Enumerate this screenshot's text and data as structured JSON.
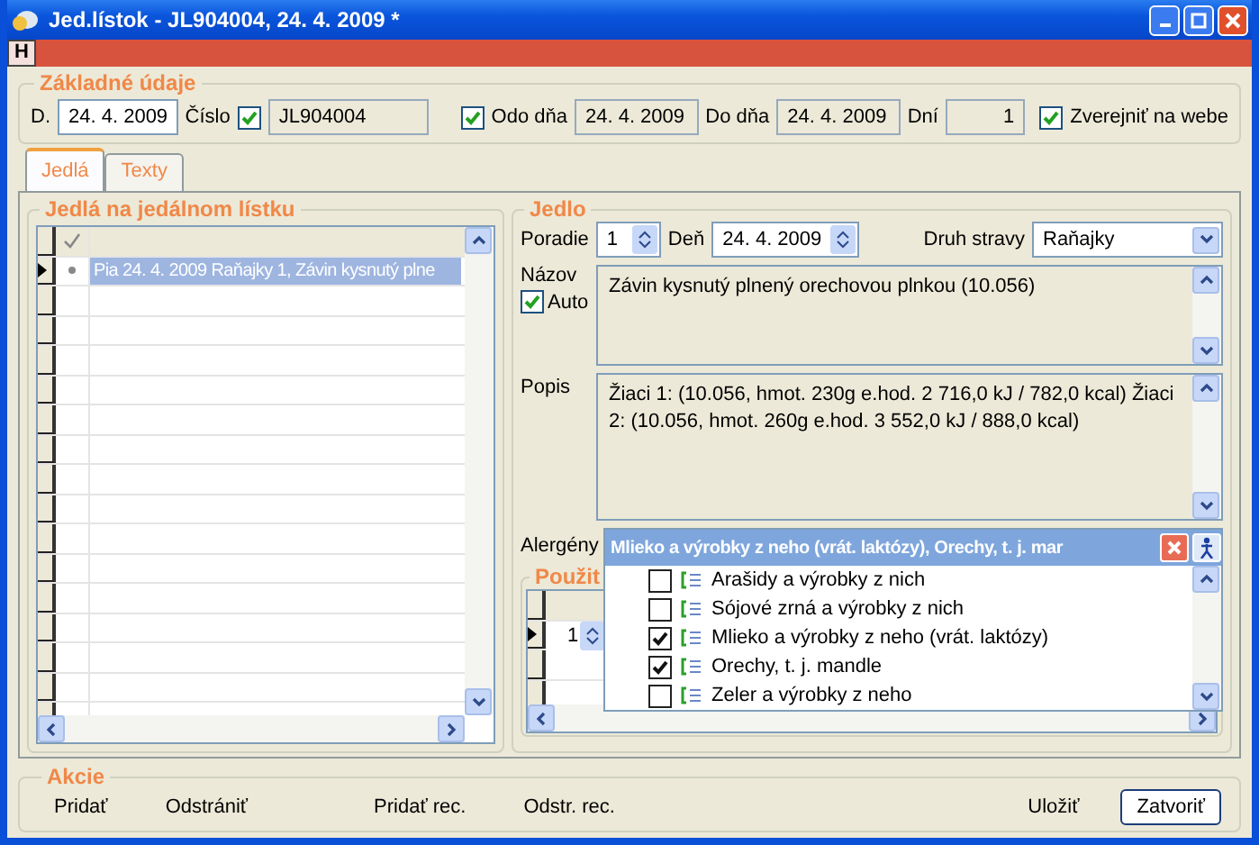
{
  "window": {
    "title": "Jed.lístok - JL904004, 24. 4. 2009 *"
  },
  "toolbar": {
    "button": "H"
  },
  "basic": {
    "title": "Základné údaje",
    "date_label": "D.",
    "date": "24. 4. 2009",
    "number_label": "Číslo",
    "number_checked": true,
    "number": "JL904004",
    "from_checked": true,
    "from_label": "Odo dňa",
    "from": "24. 4. 2009",
    "to_label": "Do dňa",
    "to": "24. 4. 2009",
    "days_label": "Dní",
    "days": "1",
    "publish_checked": true,
    "publish_label": "Zverejniť na webe"
  },
  "tabs": [
    {
      "label": "Jedlá",
      "selected": true
    },
    {
      "label": "Texty",
      "selected": false
    }
  ],
  "meals_list": {
    "title": "Jedlá na jedálnom lístku",
    "rows": [
      {
        "text": "Pia 24. 4. 2009 Raňajky 1, Závin kysnutý plne",
        "selected": true
      }
    ]
  },
  "meal": {
    "title": "Jedlo",
    "order_label": "Poradie",
    "order": "1",
    "day_label": "Deň",
    "day": "24. 4. 2009",
    "type_label": "Druh stravy",
    "type": "Raňajky",
    "name_label": "Názov",
    "auto_label": "Auto",
    "auto_checked": true,
    "name": "Závin kysnutý plnený orechovou plnkou (10.056)",
    "desc_label": "Popis",
    "desc": "Žiaci 1: (10.056, hmot. 230g  e.hod. 2 716,0 kJ / 782,0 kcal) Žiaci 2: (10.056, hmot. 260g  e.hod. 3 552,0 kJ / 888,0 kcal)",
    "allergens_label": "Alergény",
    "allergens_value": "Mlieko a výrobky z neho (vrát. laktózy), Orechy, t. j. mar",
    "allergen_options": [
      {
        "label": "Arašidy a výrobky z nich",
        "checked": false
      },
      {
        "label": "Sójové zrná a výrobky z nich",
        "checked": false
      },
      {
        "label": "Mlieko a výrobky z neho (vrát. laktózy)",
        "checked": true
      },
      {
        "label": "Orechy, t. j. mandle",
        "checked": true
      },
      {
        "label": "Zeler a výrobky z neho",
        "checked": false
      }
    ],
    "used": {
      "title": "Použit",
      "rows": [
        {
          "order": "1"
        }
      ]
    }
  },
  "actions": {
    "title": "Akcie",
    "buttons": [
      {
        "label": "Pridať",
        "kind": "flat"
      },
      {
        "label": "Odstrániť",
        "kind": "flat"
      },
      {
        "label": "Pridať rec.",
        "kind": "flat"
      },
      {
        "label": "Odstr. rec.",
        "kind": "flat"
      },
      {
        "label": "Uložiť",
        "kind": "flat"
      },
      {
        "label": "Zatvoriť",
        "kind": "default"
      }
    ]
  }
}
